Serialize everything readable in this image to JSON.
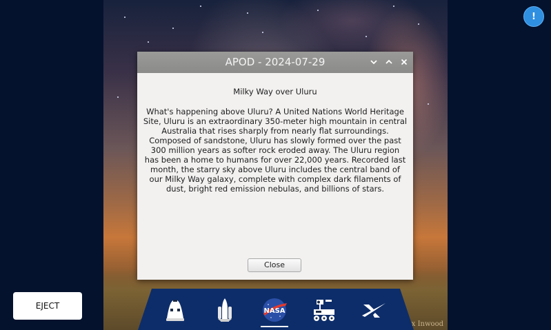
{
  "dialog": {
    "title": "APOD - 2024-07-29",
    "heading": "Milky Way over Uluru",
    "description": "What's happening above Uluru?  A United Nations World Heritage Site, Uluru  is an extraordinary 350-meter high mountain in central Australia that rises sharply from nearly flat surroundings. Composed of sandstone, Uluru has slowly formed over the past 300 million years as softer rock eroded away.  The Uluru region has been a home to humans for over 22,000 years. Recorded  last month, the starry sky above Uluru includes the central band of our Milky Way galaxy, complete with complex dark filaments of dust, bright red emission nebulas, and billions of stars.",
    "close_label": "Close",
    "controls": {
      "minimize_icon": "chevron-down-icon",
      "maximize_icon": "chevron-up-icon",
      "close_icon": "close-icon"
    }
  },
  "alert": {
    "label": "!",
    "color": "#2f8fe0"
  },
  "eject": {
    "label": "EJECT"
  },
  "photo": {
    "credit": "Max Inwood"
  },
  "dock": {
    "items": [
      {
        "name": "dragon-capsule",
        "icon": "capsule-icon",
        "active": false
      },
      {
        "name": "shuttle",
        "icon": "rocket-icon",
        "active": false
      },
      {
        "name": "nasa",
        "icon": "nasa-logo-icon",
        "active": true
      },
      {
        "name": "rover",
        "icon": "rover-icon",
        "active": false
      },
      {
        "name": "spacex",
        "icon": "spacex-logo-icon",
        "active": false
      }
    ],
    "background": "#0d2d6a"
  }
}
